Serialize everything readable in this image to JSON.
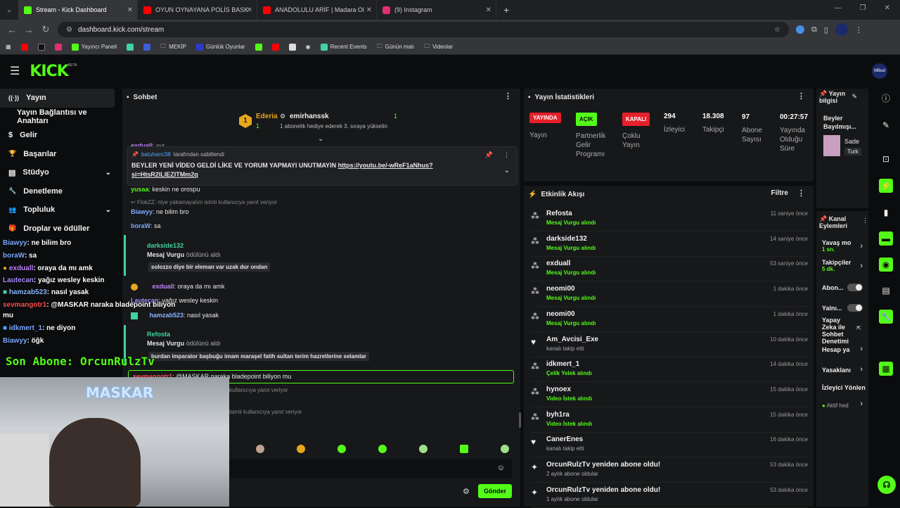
{
  "browser": {
    "tabs": [
      {
        "title": "Stream - Kick Dashboard",
        "color": "#53fc18"
      },
      {
        "title": "OYUN OYNAYANA POLİS BASK",
        "color": "#ff0000"
      },
      {
        "title": "ANADOLULU ARİF | Madara Ol",
        "color": "#ff0000"
      },
      {
        "title": "(9) Instagram",
        "color": "#e1306c"
      }
    ],
    "new_tab": "+",
    "url": "dashboard.kick.com/stream",
    "bookmarks": [
      "Yayıncı Paneli",
      "MEKİP",
      "Günlük Oyunlar",
      "Recent Events",
      "Günün malı",
      "Videolar"
    ]
  },
  "kick": {
    "logo": "KICK",
    "logo_sup": "BETA",
    "avatar_label": "MBud"
  },
  "sidebar": {
    "items": [
      {
        "label": "Yayın",
        "icon": "((·))",
        "active": true
      },
      {
        "label": "Yayın Bağlantısı ve Anahtarı",
        "icon": ""
      },
      {
        "label": "Gelir",
        "icon": "$"
      },
      {
        "label": "Başarılar",
        "icon": "🏆"
      },
      {
        "label": "Stüdyo",
        "icon": "▤",
        "chevron": "⌄"
      },
      {
        "label": "Denetleme",
        "icon": "🔧"
      },
      {
        "label": "Topluluk",
        "icon": "👥",
        "chevron": "⌄"
      },
      {
        "label": "Droplar ve ödüller",
        "icon": "🎁"
      }
    ]
  },
  "overlay_chat": [
    {
      "user": "Biawyy",
      "text": ": ne bilim bro",
      "color": "#7aa8ff"
    },
    {
      "user": "boraW",
      "text": ": sa",
      "color": "#7aa8ff"
    },
    {
      "user": "exduall",
      "text": ": oraya da mı amk",
      "color": "#c081ff"
    },
    {
      "user": "Lautecan",
      "text": ": yağız wesley keskin",
      "color": "#a78bfa"
    },
    {
      "user": "hamzab523",
      "text": ": nasıl yasak",
      "color": "#8ab4ff"
    },
    {
      "user": "sevmangotr1",
      "text": ": @MASKAR naraka bladepoint biliyon",
      "color": "#ff4d4d"
    },
    {
      "user": "",
      "text": "mu",
      "color": "#fff"
    },
    {
      "user": "idkmert_1",
      "text": ": ne diyon",
      "color": "#7aa8ff"
    },
    {
      "user": "Biawyy",
      "text": ": öğk",
      "color": "#7aa8ff"
    }
  ],
  "overlay_sub": "Son Abone: OrcunRulzTv",
  "webcam_text": "MASKAR",
  "chat": {
    "title": "Sohbet",
    "leaderboard": {
      "rank": "1",
      "user1": "Ederia",
      "user1_count": "1",
      "user2": "emirhanssk",
      "user2_count": "1",
      "note": "1 abonelik hediye ederek 3. sıraya yükselin"
    },
    "pinned_by_user": "batuhanc38",
    "pinned_by_suffix": "tarafından sabitlendi",
    "pinned_text": "BEYLER YENİ VİDEO GELDİ LİKE VE YORUM YAPMAYI UNUTMAYIN ",
    "pinned_link": "https://youtu.be/-wReF1aNhus?si=HtsR2lLIEZITMm2q",
    "partial_top_user": "exduall",
    "partial_top_text": ": evt",
    "messages": [
      {
        "user": "yusaa",
        "text": ": keskin ne orospu",
        "color": "#53fc18"
      },
      {
        "user": "",
        "text": "↩ FlokZZ: niye yakamayalım isimli kullanıcıya yanıt veriyor",
        "color": "#888"
      },
      {
        "user": "Biawyy",
        "text": ": ne bilim bro",
        "color": "#7aa8ff"
      },
      {
        "user": "boraW",
        "text": ": sa",
        "color": "#7aa8ff"
      }
    ],
    "reward1_user": "darkside132",
    "reward1_title": "Mesaj Vurgu",
    "reward1_action": "ödülünü aldı",
    "reward1_text": "solozzo diye bir eleman var uzak dur ondan",
    "mid_messages": [
      {
        "user": "exduall",
        "text": ": oraya da mı amk",
        "color": "#c081ff"
      },
      {
        "user": "Lautecan",
        "text": ": yağız wesley keskin",
        "color": "#a78bfa"
      },
      {
        "user": "hamzab523",
        "text": ": nasıl yasak",
        "color": "#8ab4ff"
      }
    ],
    "reward2_user": "Refosta",
    "reward2_title": "Mesaj Vurgu",
    "reward2_action": "ödülünü aldı",
    "reward2_text": "burdan imparator başbuğu imam maraşel fatih sultan terim hazretlerine selamlar",
    "highlight_user": "sevmangotr1",
    "highlight_text": ": @MASKAR naraka bladepoint biliyon mu",
    "reply_note1": "kullanıcıya yanıt veriyor",
    "reply_note2": "isimli kullanıcıya yanıt veriyor",
    "send_label": "Gönder"
  },
  "stats": {
    "title": "Yayın İstatistikleri",
    "items": [
      {
        "badge": "YAYINDA",
        "badge_color": "#e5202a",
        "label": "Yayın"
      },
      {
        "badge": "AÇIK",
        "badge_color": "#53fc18",
        "label": "Partnerlik Gelir Programı"
      },
      {
        "badge": "KAPALI",
        "badge_color": "#e5202a",
        "label": "Çoklu Yayın"
      },
      {
        "value": "294",
        "label": "İzleyici"
      },
      {
        "value": "18.308",
        "label": "Takipçi"
      },
      {
        "value": "97",
        "label": "Abone Sayısı"
      },
      {
        "value": "00:27:57",
        "label": "Yayında Olduğu Süre"
      }
    ]
  },
  "activity": {
    "title": "Etkinlik Akışı",
    "filter": "Filtre",
    "rows": [
      {
        "icon": "⁂",
        "name": "Refosta",
        "sub": "Mesaj Vurgu alındı",
        "time": "11 saniye önce",
        "green": true
      },
      {
        "icon": "⁂",
        "name": "darkside132",
        "sub": "Mesaj Vurgu alındı",
        "time": "14 saniye önce",
        "green": true
      },
      {
        "icon": "⁂",
        "name": "exduall",
        "sub": "Mesaj Vurgu alındı",
        "time": "53 saniye önce",
        "green": true
      },
      {
        "icon": "⁂",
        "name": "neomi00",
        "sub": "Mesaj Vurgu alındı",
        "time": "1 dakika önce",
        "green": true
      },
      {
        "icon": "⁂",
        "name": "neomi00",
        "sub": "Mesaj Vurgu alındı",
        "time": "1 dakika önce",
        "green": true
      },
      {
        "icon": "♥",
        "name": "Am_Avcisi_Exe",
        "sub": "kanalı takip etti",
        "time": "10 dakika önce",
        "green": false
      },
      {
        "icon": "⁂",
        "name": "idkmert_1",
        "sub": "Çelik Yelek alındı",
        "time": "14 dakika önce",
        "green": true
      },
      {
        "icon": "⁂",
        "name": "hynoex",
        "sub": "Video İstek alındı",
        "time": "15 dakika önce",
        "green": true
      },
      {
        "icon": "⁂",
        "name": "byh1ra",
        "sub": "Video İstek alındı",
        "time": "15 dakika önce",
        "green": true
      },
      {
        "icon": "♥",
        "name": "CanerEnes",
        "sub": "kanalı takip etti",
        "time": "16 dakika önce",
        "green": false
      },
      {
        "icon": "✦",
        "name": "OrcunRulzTv yeniden abone oldu!",
        "sub": "2 aylık abone oldular",
        "time": "53 dakika önce",
        "green": false
      },
      {
        "icon": "✦",
        "name": "OrcunRulzTv yeniden abone oldu!",
        "sub": "1 aylık abone oldular",
        "time": "53 dakika önce",
        "green": false
      }
    ]
  },
  "stream_info": {
    "title": "Yayın bilgisi",
    "stream_title": "Beyler Bayılmışı...",
    "category": "Sade",
    "tag": "Turk"
  },
  "channel_actions": {
    "title": "Kanal Eylemleri",
    "items": [
      {
        "label": "Yavaş mo",
        "sub": "1 sn.",
        "type": "chevron"
      },
      {
        "label": "Takipçiler",
        "sub": "5 dk.",
        "type": "chevron"
      },
      {
        "label": "Abon...",
        "type": "toggle"
      },
      {
        "label": "Yalnı...",
        "type": "toggle"
      },
      {
        "label": "Yapay Zeka ile Sohbet Denetimi",
        "type": "ext"
      },
      {
        "label": "Hesap ya",
        "type": "chevron"
      },
      {
        "label": "Yasaklanı",
        "type": "chevron"
      },
      {
        "label": "İzleyici Yönlen",
        "type": "none"
      },
      {
        "label": "Aktif hed",
        "type": "chevron"
      }
    ]
  }
}
